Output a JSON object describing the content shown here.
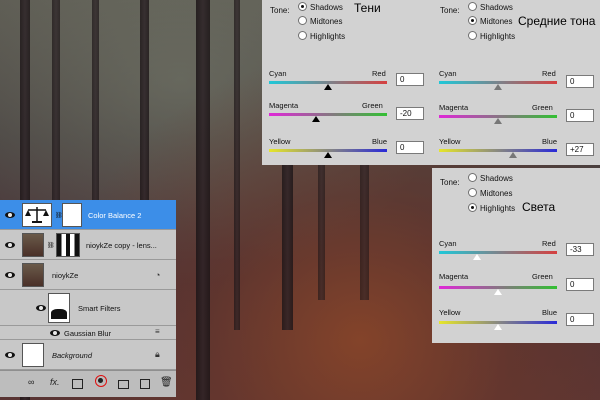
{
  "color_balance": {
    "shadows_panel": {
      "tone_label": "Tone:",
      "options": [
        "Shadows",
        "Midtones",
        "Highlights"
      ],
      "selected": "Shadows",
      "annotation": "Тени",
      "sliders": [
        {
          "left": "Cyan",
          "right": "Red",
          "value": "0"
        },
        {
          "left": "Magenta",
          "right": "Green",
          "value": "-20"
        },
        {
          "left": "Yellow",
          "right": "Blue",
          "value": "0"
        }
      ]
    },
    "midtones_panel": {
      "tone_label": "Tone:",
      "options": [
        "Shadows",
        "Midtones",
        "Highlights"
      ],
      "selected": "Midtones",
      "annotation": "Средние тона",
      "sliders": [
        {
          "left": "Cyan",
          "right": "Red",
          "value": "0"
        },
        {
          "left": "Magenta",
          "right": "Green",
          "value": "0"
        },
        {
          "left": "Yellow",
          "right": "Blue",
          "value": "+27"
        }
      ]
    },
    "highlights_panel": {
      "tone_label": "Tone:",
      "options": [
        "Shadows",
        "Midtones",
        "Highlights"
      ],
      "selected": "Highlights",
      "annotation": "Света",
      "sliders": [
        {
          "left": "Cyan",
          "right": "Red",
          "value": "-33"
        },
        {
          "left": "Magenta",
          "right": "Green",
          "value": "0"
        },
        {
          "left": "Yellow",
          "right": "Blue",
          "value": "0"
        }
      ]
    }
  },
  "layers_panel": {
    "layers": [
      {
        "name": "Color Balance 2",
        "selected": true
      },
      {
        "name": "nioykZe copy - lens...",
        "selected": false
      },
      {
        "name": "nioykZe",
        "selected": false
      },
      {
        "name": "Smart Filters",
        "selected": false
      },
      {
        "name": "Gaussian Blur",
        "selected": false
      },
      {
        "name": "Background",
        "selected": false
      }
    ],
    "bottom_icons": [
      "link-icon",
      "fx-icon",
      "mask-icon",
      "adjustment-icon",
      "group-icon",
      "new-layer-icon",
      "trash-icon"
    ],
    "fx_label": "fx."
  },
  "colors": {
    "selected_layer": "#3c8ee8",
    "highlight_circle": "#e01010"
  }
}
